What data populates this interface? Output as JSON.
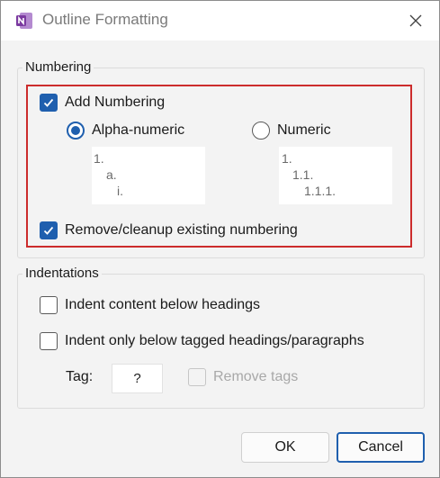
{
  "window": {
    "title": "Outline Formatting",
    "app_icon": "onenote-icon",
    "close_icon": "close-icon"
  },
  "numbering": {
    "legend": "Numbering",
    "add_numbering": {
      "label": "Add Numbering",
      "checked": true
    },
    "alpha_numeric": {
      "label": "Alpha-numeric",
      "selected": true,
      "preview": [
        "1.",
        "a.",
        "i."
      ]
    },
    "numeric": {
      "label": "Numeric",
      "selected": false,
      "preview": [
        "1.",
        "1.1.",
        "1.1.1."
      ]
    },
    "remove_cleanup": {
      "label": "Remove/cleanup existing numbering",
      "checked": true
    }
  },
  "indentations": {
    "legend": "Indentations",
    "indent_content": {
      "label": "Indent content below headings",
      "checked": false
    },
    "indent_tagged": {
      "label": "Indent only below tagged headings/paragraphs",
      "checked": false
    },
    "tag_label": "Tag:",
    "tag_value": "?",
    "remove_tags": {
      "label": "Remove tags",
      "checked": false,
      "disabled": true
    }
  },
  "buttons": {
    "ok": "OK",
    "cancel": "Cancel"
  },
  "colors": {
    "accent": "#1f5fae",
    "highlight": "#cc2c2c",
    "app_icon": "#7b3aa0"
  }
}
